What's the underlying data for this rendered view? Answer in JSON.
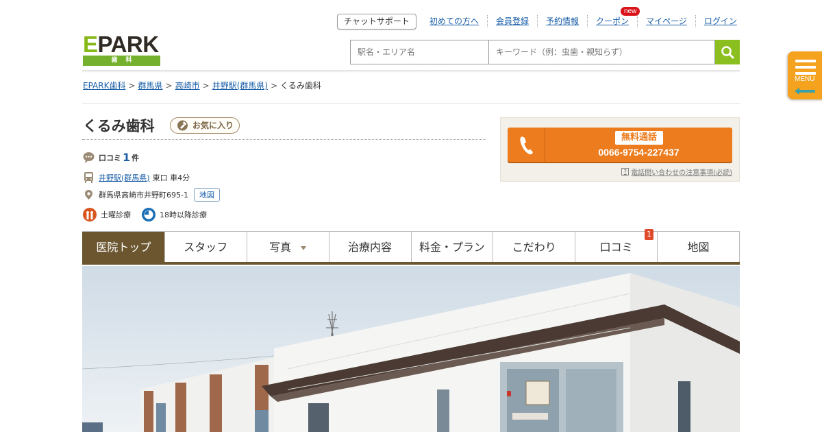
{
  "header": {
    "logo_text": "EPARK",
    "logo_sub": "歯科",
    "chat_support": "チャットサポート",
    "nav": [
      {
        "label": "初めての方へ"
      },
      {
        "label": "会員登録"
      },
      {
        "label": "予約情報"
      },
      {
        "label": "クーポン"
      },
      {
        "label": "マイページ"
      },
      {
        "label": "ログイン"
      }
    ],
    "new_badge": "new",
    "search": {
      "area_placeholder": "駅名・エリア名",
      "keyword_placeholder": "キーワード（例：虫歯・親知らず）"
    },
    "menu_label": "MENU"
  },
  "breadcrumb": [
    {
      "label": "EPARK歯科"
    },
    {
      "label": "群馬県"
    },
    {
      "label": "高崎市"
    },
    {
      "label": "井野駅(群馬県)"
    },
    {
      "label": "くるみ歯科"
    }
  ],
  "clinic": {
    "name": "くるみ歯科",
    "favorite_label": "お気に入り",
    "review_label": "口コミ",
    "review_count": "1",
    "review_unit": "件",
    "station_link": "井野駅(群馬県)",
    "access": "東口 車4分",
    "address": "群馬県高崎市井野町695-1",
    "map_button": "地図",
    "features": [
      {
        "label": "土曜診療"
      },
      {
        "label": "18時以降診療"
      }
    ]
  },
  "phone": {
    "badge": "無料通話",
    "number": "0066-9754-227437",
    "note": "電話問い合わせの注意事項(必読)"
  },
  "tabs": [
    {
      "label": "医院トップ"
    },
    {
      "label": "スタッフ"
    },
    {
      "label": "写真"
    },
    {
      "label": "治療内容"
    },
    {
      "label": "料金・プラン"
    },
    {
      "label": "こだわり"
    },
    {
      "label": "口コミ",
      "count": "1"
    },
    {
      "label": "地図"
    }
  ],
  "colors": {
    "brand_green": "#8bbf1f",
    "tab_active": "#6b5630",
    "phone_orange": "#ec7c1e",
    "menu_orange": "#f5a21f"
  }
}
